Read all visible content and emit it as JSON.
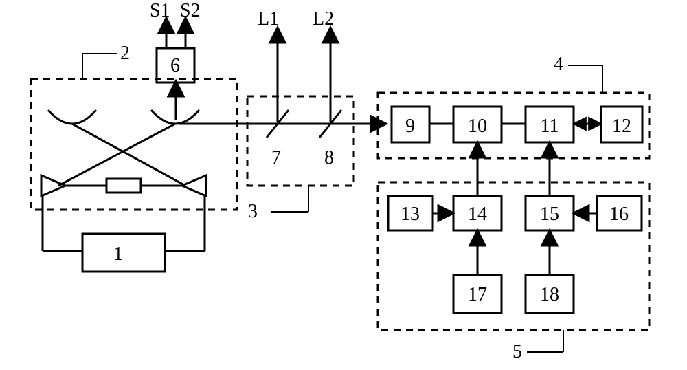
{
  "chart_data": {
    "type": "diagram",
    "title": "",
    "blocks": {
      "b1": "1",
      "b6": "6",
      "b9": "9",
      "b10": "10",
      "b11": "11",
      "b12": "12",
      "b13": "13",
      "b14": "14",
      "b15": "15",
      "b16": "16",
      "b17": "17",
      "b18": "18"
    },
    "regions": {
      "r2": "2",
      "r3": "3",
      "r4": "4",
      "r5": "5"
    },
    "optics": {
      "splitter7": "7",
      "splitter8": "8"
    },
    "outputs": {
      "s1": "S1",
      "s2": "S2",
      "l1": "L1",
      "l2": "L2"
    }
  }
}
